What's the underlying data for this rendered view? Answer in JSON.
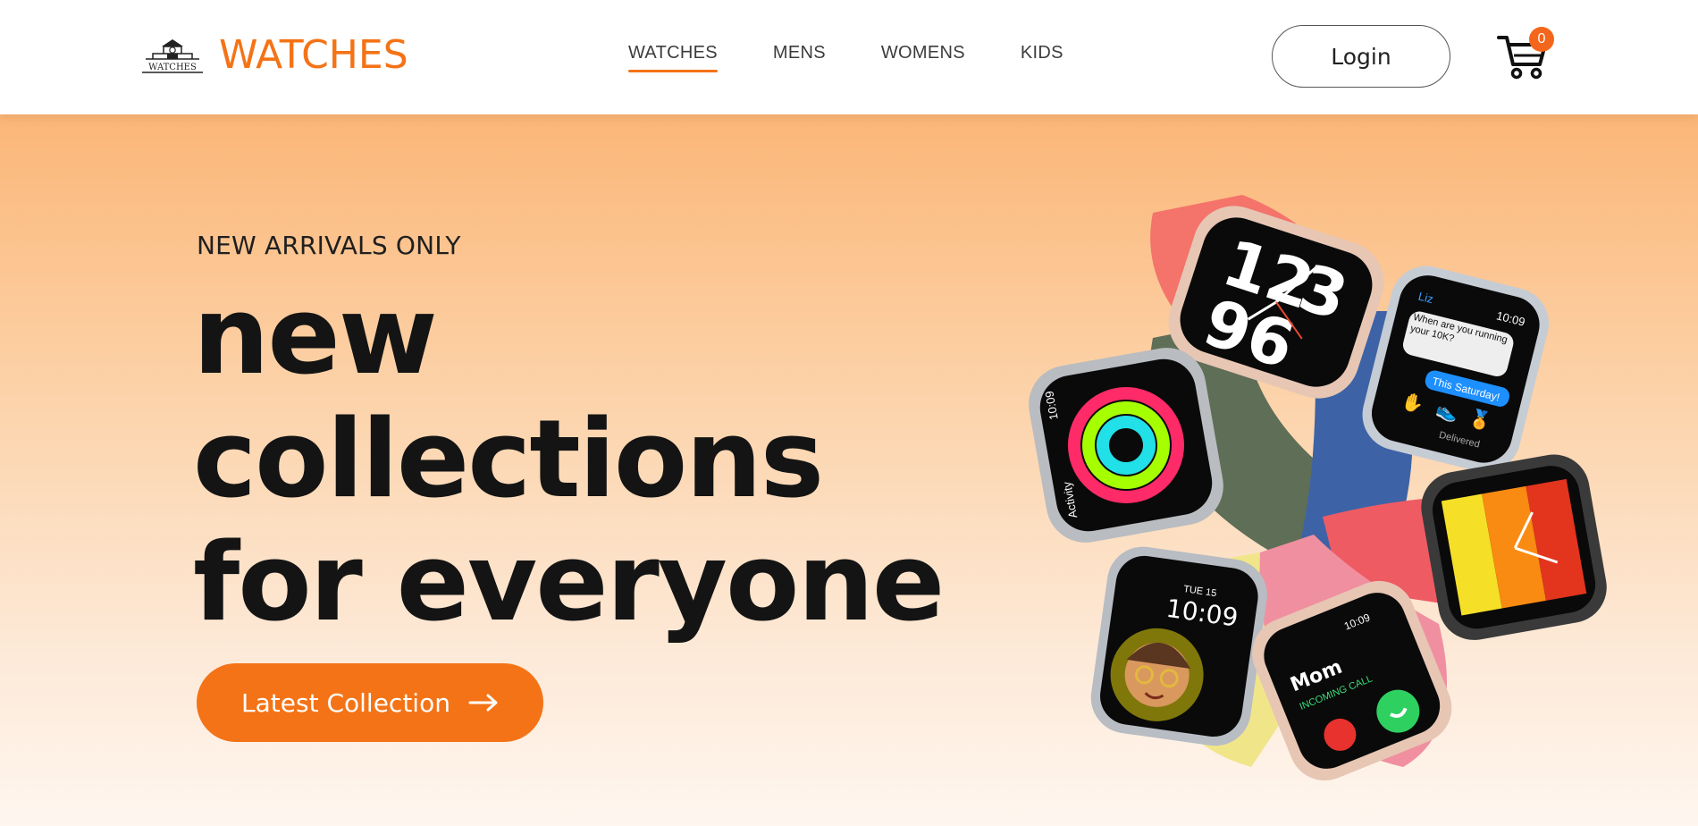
{
  "brand": {
    "name": "WATCHES",
    "logo_caption": "WATCHES",
    "accent_color": "#f47316"
  },
  "nav": {
    "items": [
      {
        "label": "WATCHES",
        "active": true
      },
      {
        "label": "MENS",
        "active": false
      },
      {
        "label": "WOMENS",
        "active": false
      },
      {
        "label": "KIDS",
        "active": false
      }
    ]
  },
  "header": {
    "login_label": "Login",
    "cart_count": "0",
    "cart_icon": "cart-icon"
  },
  "hero": {
    "eyebrow": "NEW ARRIVALS ONLY",
    "headline": [
      "new",
      "collections",
      "for everyone"
    ],
    "cta_label": "Latest Collection",
    "cta_icon": "arrow-right-icon",
    "image": {
      "time_big": [
        "12",
        "96"
      ],
      "time_big_right": "3",
      "message_time": "10:09",
      "message_contact": "Liz",
      "message_text": "When are you running your 10K?",
      "message_reply": "This Saturday!",
      "message_status": "Delivered",
      "activity_time": "10:09",
      "activity_label": "Activity",
      "memoji_date": "TUE 15",
      "memoji_time": "10:09",
      "call_time": "10:09",
      "call_name": "Mom",
      "call_status": "INCOMING CALL"
    }
  }
}
